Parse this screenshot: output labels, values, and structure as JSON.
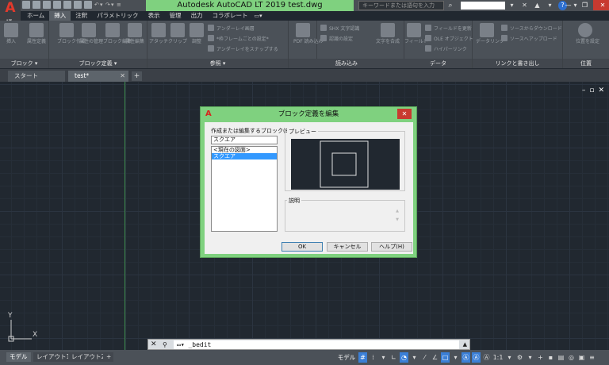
{
  "app": {
    "logo_letter": "A",
    "logo_sub": "LT",
    "title": "Autodesk AutoCAD LT 2019    test.dwg",
    "search_placeholder": "キーワードまたは語句を入力"
  },
  "ribbon_tabs": [
    "ホーム",
    "挿入",
    "注釈",
    "パラメトリック",
    "表示",
    "管理",
    "出力",
    "コラボレート"
  ],
  "ribbon_active_tab": "挿入",
  "ribbon_panels": {
    "block": {
      "title": "ブロック ▾",
      "buttons": [
        "挿入",
        "属性定義"
      ]
    },
    "block_def": {
      "title": "ブロック定義 ▾",
      "buttons": [
        "ブロック作成",
        "属性の管理",
        "ブロック編集",
        "属性編集"
      ]
    },
    "reference": {
      "title": "参照 ▾",
      "buttons": [
        "アタッチ",
        "クリップ",
        "調整"
      ],
      "rows": [
        "アンダーレイ画層",
        "*枠フレームごとの設定*",
        "アンダーレイをスナップする"
      ]
    },
    "import": {
      "title": "読み込み",
      "buttons": [
        "PDF 読み込み"
      ]
    },
    "data": {
      "title": "データ",
      "rows_left": [
        "SHX 文字認識",
        "認識の設定"
      ],
      "buttons": [
        "文字を合成"
      ],
      "buttons2": [
        "フィールド"
      ],
      "rows_right": [
        "フィールドを更新",
        "OLE オブジェクト",
        "ハイパーリンク"
      ]
    },
    "links": {
      "title": "リンクと書き出し",
      "buttons": [
        "データリンク"
      ],
      "rows": [
        "ソースからダウンロード",
        "ソースへアップロード"
      ]
    },
    "location": {
      "title": "位置",
      "buttons": [
        "位置を設定"
      ]
    }
  },
  "file_tabs": [
    {
      "label": "スタート",
      "active": false
    },
    {
      "label": "test*",
      "active": true
    }
  ],
  "dialog": {
    "title": "ブロック定義を編集",
    "block_label": "作成または編集するブロック(B)",
    "block_name": "スクエア",
    "list_items": [
      "<現在の図面>",
      "スクエア"
    ],
    "selected_index": 1,
    "preview_label": "プレビュー",
    "description_label": "説明",
    "ok": "OK",
    "cancel": "キャンセル",
    "help": "ヘルプ(H)"
  },
  "command_line": {
    "text": "_bedit"
  },
  "ucs": {
    "y": "Y",
    "x": "X"
  },
  "layout_tabs": [
    "モデル",
    "レイアウト1",
    "レイアウト2"
  ],
  "status": {
    "model": "モデル",
    "scale": "1:1"
  },
  "colors": {
    "title_bar_accent": "#7fd17f",
    "canvas_bg": "#212830",
    "selection": "#3399ff",
    "close_red": "#c83a30"
  }
}
